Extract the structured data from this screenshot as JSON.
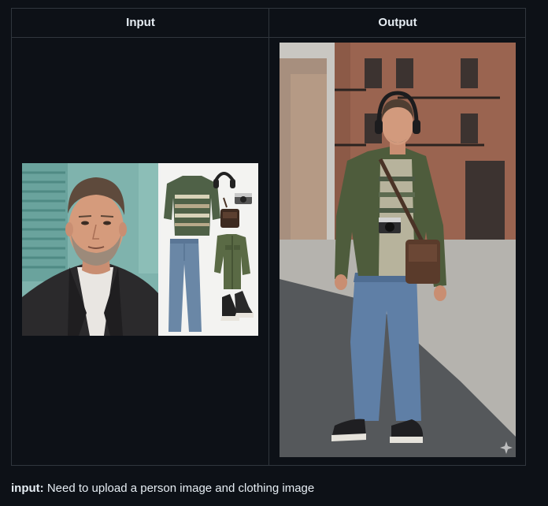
{
  "table": {
    "header_input": "Input",
    "header_output": "Output"
  },
  "caption": {
    "label": "input:",
    "text": " Need to upload a person image and clothing image"
  },
  "colors": {
    "page_background": "#0d1117",
    "border": "#30363d",
    "text": "#e6edf3"
  }
}
